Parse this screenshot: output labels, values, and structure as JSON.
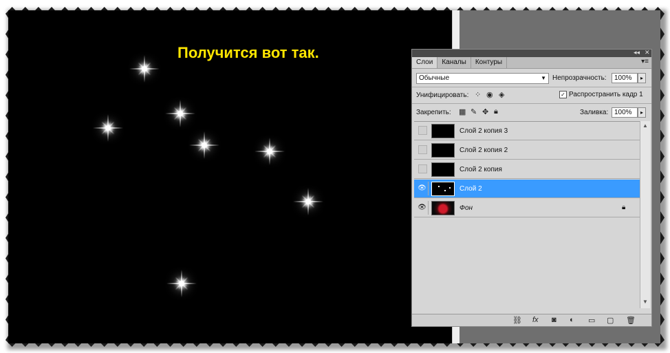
{
  "caption": "Получится вот так.",
  "colors": {
    "caption": "#ffe600",
    "selected_layer": "#3a9bff",
    "canvas": "#000000"
  },
  "panel": {
    "tabs": [
      {
        "label": "Слои",
        "active": true
      },
      {
        "label": "Каналы",
        "active": false
      },
      {
        "label": "Контуры",
        "active": false
      }
    ],
    "blend_mode": "Обычные",
    "opacity_label": "Непрозрачность:",
    "opacity_value": "100%",
    "unify_label": "Унифицировать:",
    "propagate_label": "Распространить кадр 1",
    "propagate_checked": true,
    "lock_label": "Закрепить:",
    "fill_label": "Заливка:",
    "fill_value": "100%",
    "layers": [
      {
        "name": "Слой 2 копия 3",
        "visible": false,
        "selected": false
      },
      {
        "name": "Слой 2 копия 2",
        "visible": false,
        "selected": false
      },
      {
        "name": "Слой 2 копия",
        "visible": false,
        "selected": false
      },
      {
        "name": "Слой 2",
        "visible": true,
        "selected": true
      },
      {
        "name": "Фон",
        "visible": true,
        "selected": false,
        "locked": true
      }
    ],
    "bottom_icons": [
      "link-icon",
      "fx-icon",
      "mask-icon",
      "adjustment-icon",
      "folder-icon",
      "new-layer-icon",
      "trash-icon"
    ]
  }
}
